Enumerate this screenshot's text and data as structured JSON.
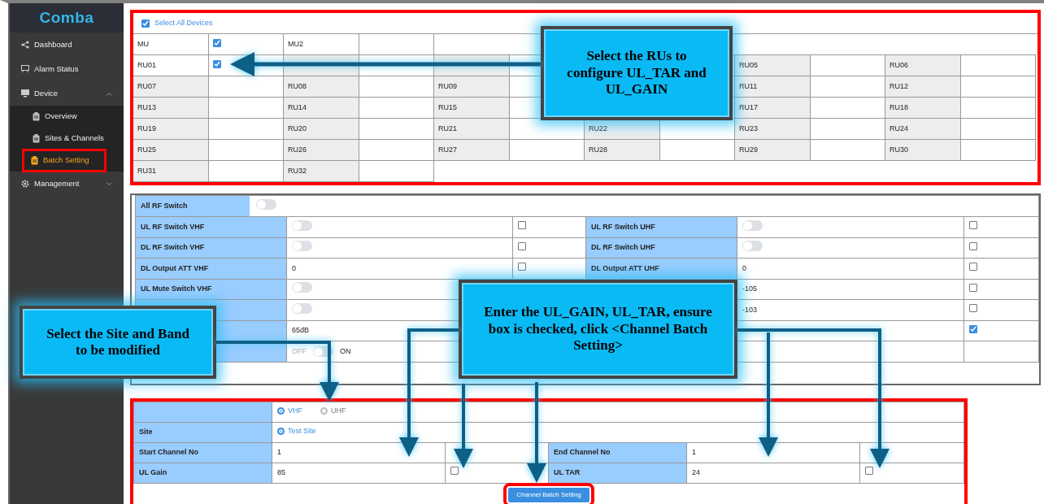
{
  "sidebar": {
    "logo": "Comba",
    "items": [
      {
        "label": "Dashboard",
        "selected": false
      },
      {
        "label": "Alarm Status",
        "selected": false
      },
      {
        "label": "Device",
        "selected": false,
        "expanded": true,
        "children": [
          {
            "label": "Overview",
            "selected": false
          },
          {
            "label": "Sites & Channels",
            "selected": false
          },
          {
            "label": "Batch Setting",
            "selected": true
          }
        ]
      },
      {
        "label": "Management",
        "selected": false,
        "expanded": false
      }
    ]
  },
  "devices": {
    "select_all": {
      "label": "Select All Devices",
      "checked": true
    },
    "rows": [
      [
        {
          "label": "MU",
          "checked": true
        },
        {
          "label": "MU2"
        }
      ],
      [
        {
          "label": "RU01",
          "checked": true
        },
        null,
        null,
        null,
        {
          "label": "RU05"
        },
        {
          "label": "RU06"
        }
      ],
      [
        {
          "label": "RU07"
        },
        {
          "label": "RU08"
        },
        {
          "label": "RU09"
        },
        null,
        {
          "label": "RU11"
        },
        {
          "label": "RU12"
        }
      ],
      [
        {
          "label": "RU13"
        },
        {
          "label": "RU14"
        },
        {
          "label": "RU15"
        },
        null,
        {
          "label": "RU17"
        },
        {
          "label": "RU18"
        }
      ],
      [
        {
          "label": "RU19"
        },
        {
          "label": "RU20"
        },
        {
          "label": "RU21"
        },
        {
          "label": "RU22"
        },
        {
          "label": "RU23"
        },
        {
          "label": "RU24"
        }
      ],
      [
        {
          "label": "RU25"
        },
        {
          "label": "RU26"
        },
        {
          "label": "RU27"
        },
        {
          "label": "RU28"
        },
        {
          "label": "RU29"
        },
        {
          "label": "RU30"
        }
      ],
      [
        {
          "label": "RU31"
        },
        {
          "label": "RU32"
        }
      ]
    ]
  },
  "rf": {
    "all_switch": {
      "label": "All RF Switch",
      "on": false
    },
    "rows": [
      {
        "vhf": {
          "label": "UL RF Switch VHF",
          "kind": "toggle",
          "on": false,
          "checked": false
        },
        "uhf": {
          "label": "UL RF Switch UHF",
          "kind": "toggle",
          "on": false,
          "checked": false
        }
      },
      {
        "vhf": {
          "label": "DL RF Switch VHF",
          "kind": "toggle",
          "on": false,
          "checked": false
        },
        "uhf": {
          "label": "DL RF Switch UHF",
          "kind": "toggle",
          "on": false,
          "checked": false
        }
      },
      {
        "vhf": {
          "label": "DL Output ATT VHF",
          "kind": "value",
          "value": "0",
          "checked": false
        },
        "uhf": {
          "label": "DL Output ATT UHF",
          "kind": "value",
          "value": "0",
          "checked": false
        }
      },
      {
        "vhf": {
          "label": "UL Mute Switch VHF",
          "kind": "toggle",
          "on": false
        },
        "uhf": {
          "kind": "value",
          "value": "-105",
          "checked": false
        }
      },
      {
        "vhf": {
          "kind": "toggle",
          "on": false
        },
        "uhf": {
          "kind": "value",
          "value": "-103",
          "checked": false
        }
      },
      {
        "vhf": {
          "kind": "value",
          "value": "65dB"
        },
        "uhf": {
          "checked": true
        }
      },
      {
        "vhf": {
          "kind": "switch_pair",
          "off_label": "OFF",
          "on_label": "ON",
          "on": false
        },
        "uhf": {}
      }
    ]
  },
  "channel_form": {
    "band": {
      "options": [
        {
          "label": "VHF",
          "selected": true
        },
        {
          "label": "UHF",
          "selected": false
        }
      ]
    },
    "site": {
      "label": "Site",
      "options": [
        {
          "label": "Test Site",
          "selected": true
        }
      ]
    },
    "fields": [
      {
        "label": "Start Channel No",
        "value": "1"
      },
      {
        "label": "End Channel No",
        "value": "1"
      },
      {
        "label": "UL Gain",
        "value": "85",
        "checked": false
      },
      {
        "label": "UL TAR",
        "value": "24",
        "checked": false
      }
    ],
    "button": "Channel Batch Setting"
  },
  "callouts": [
    {
      "text": "Select the RUs to configure UL_TAR and UL_GAIN"
    },
    {
      "text": "Select the Site and Band to be modified"
    },
    {
      "text": "Enter the UL_GAIN, UL_TAR, ensure box is checked, click <Channel Batch Setting>"
    }
  ]
}
